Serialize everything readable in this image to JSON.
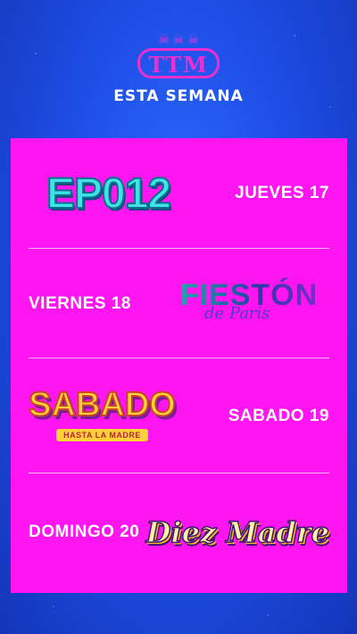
{
  "header": {
    "logo_text": "TTM",
    "subtitle": "ESTA SEMANA"
  },
  "schedule": [
    {
      "show_logo": "EP012",
      "day": "JUEVES 17"
    },
    {
      "show_logo": "FIESTÓN",
      "show_logo_script": "de Paris",
      "day": "VIERNES 18"
    },
    {
      "show_logo": "SABADO",
      "show_logo_sub": "HASTA LA MADRE",
      "day": "SABADO 19"
    },
    {
      "show_logo": "Diez Madre",
      "day": "DOMINGO 20"
    }
  ],
  "colors": {
    "background": "#1f4fe8",
    "card": "#ff15f0",
    "accent": "#ee2fd0"
  },
  "icons": [
    "skull-icon"
  ]
}
